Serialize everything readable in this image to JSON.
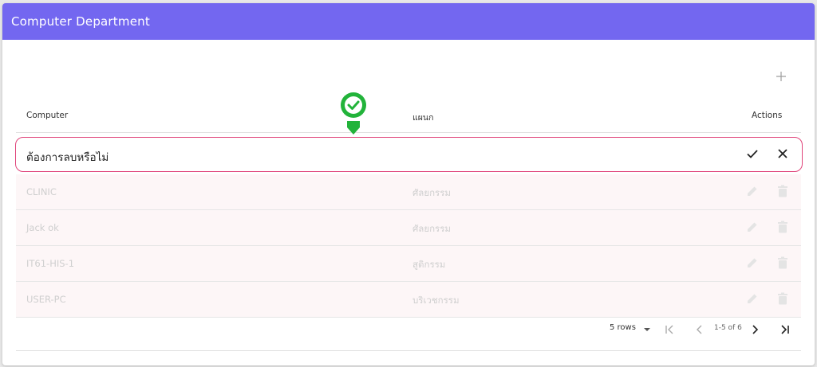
{
  "header": {
    "title": "Computer Department",
    "color": "#7367f0"
  },
  "toolbar": {
    "add_icon": "plus-icon"
  },
  "table": {
    "columns": {
      "computer": "Computer",
      "department": "แผนก",
      "actions": "Actions"
    },
    "confirm": {
      "text": "ต้องการลบหรือไม่",
      "border_color": "#e0457b"
    },
    "rows": [
      {
        "computer": "CLINIC",
        "department": "ศัลยกรรม"
      },
      {
        "computer": "Jack ok",
        "department": "ศัลยกรรม"
      },
      {
        "computer": "IT61-HIS-1",
        "department": "สูติกรรม"
      },
      {
        "computer": "USER-PC",
        "department": "บริเวชกรรม"
      }
    ]
  },
  "pagination": {
    "rows_label": "5 rows",
    "range": "1-5 of 6"
  },
  "marker": {
    "color": "#22b33a"
  }
}
